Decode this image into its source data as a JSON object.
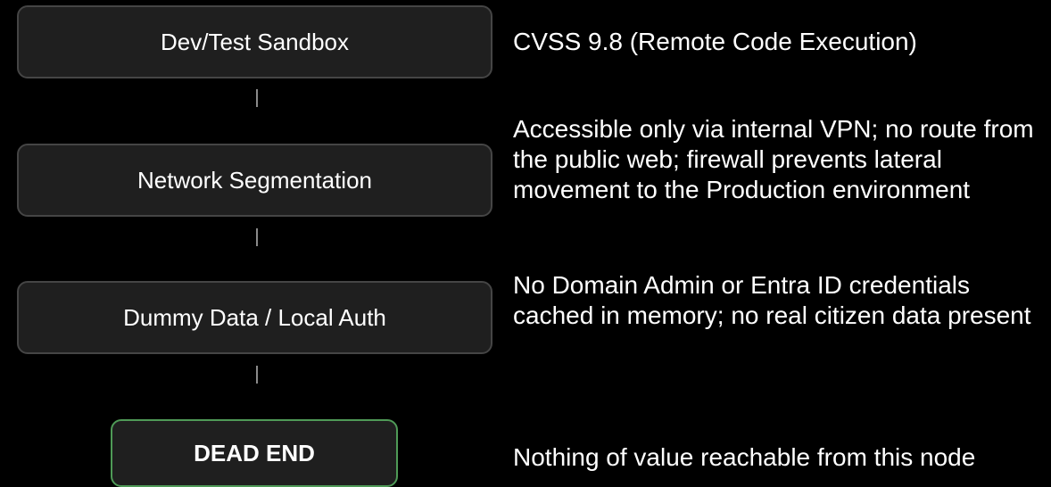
{
  "flow": {
    "nodes": [
      {
        "label": "Dev/Test Sandbox",
        "note": "CVSS 9.8 (Remote Code Execution)"
      },
      {
        "label": "Network Segmentation",
        "note": "Accessible only via internal VPN; no route from the public web; firewall prevents lateral movement to the Production environment"
      },
      {
        "label": "Dummy Data / Local Auth",
        "note": "No Domain Admin or Entra ID credentials cached in memory; no real citizen data present"
      },
      {
        "label": "DEAD END",
        "note": "Nothing of value reachable from this node"
      }
    ]
  },
  "colors": {
    "background": "#000000",
    "node_fill": "#1f1f1f",
    "node_border": "#454545",
    "terminal_border": "#4f9a57",
    "connector": "#8a8a8a",
    "text": "#ffffff"
  }
}
